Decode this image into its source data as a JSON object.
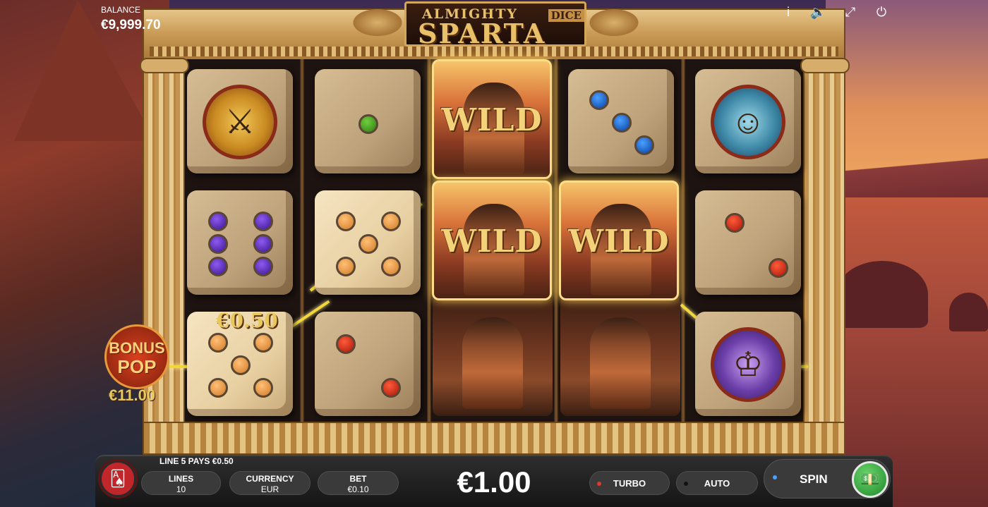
{
  "header": {
    "balance_label": "BALANCE",
    "balance_value": "€9,999.70",
    "icons": [
      "info-icon",
      "sound-icon",
      "fullscreen-icon",
      "power-icon"
    ]
  },
  "logo": {
    "line1": "ALMIGHTY",
    "line2": "SPARTA",
    "tag": "DICE"
  },
  "reels": {
    "wild_label": "WILD",
    "win_label": "€0.50",
    "symbols": [
      [
        "sword-shield",
        "purple-6",
        "orange-5"
      ],
      [
        "green-1",
        "orange-5",
        "red-2"
      ],
      [
        "wild",
        "wild",
        "warrior"
      ],
      [
        "blue-3",
        "wild",
        "warrior"
      ],
      [
        "medusa",
        "red-2",
        "king"
      ]
    ]
  },
  "bonus_pop": {
    "line1": "BONUS",
    "line2": "POP",
    "amount": "€11.00"
  },
  "bottom_bar": {
    "line_pays": "LINE 5 PAYS €0.50",
    "lines_label": "LINES",
    "lines_value": "10",
    "currency_label": "CURRENCY",
    "currency_value": "EUR",
    "bet_label": "BET",
    "bet_value": "€0.10",
    "total_bet": "€1.00",
    "turbo_label": "TURBO",
    "auto_label": "AUTO",
    "spin_label": "SPIN"
  },
  "colors": {
    "accent_gold": "#e8c06a",
    "spin_green": "#1d8a2a",
    "turbo_dot": "#e03a2a",
    "spin_dot": "#4aa0ff"
  }
}
